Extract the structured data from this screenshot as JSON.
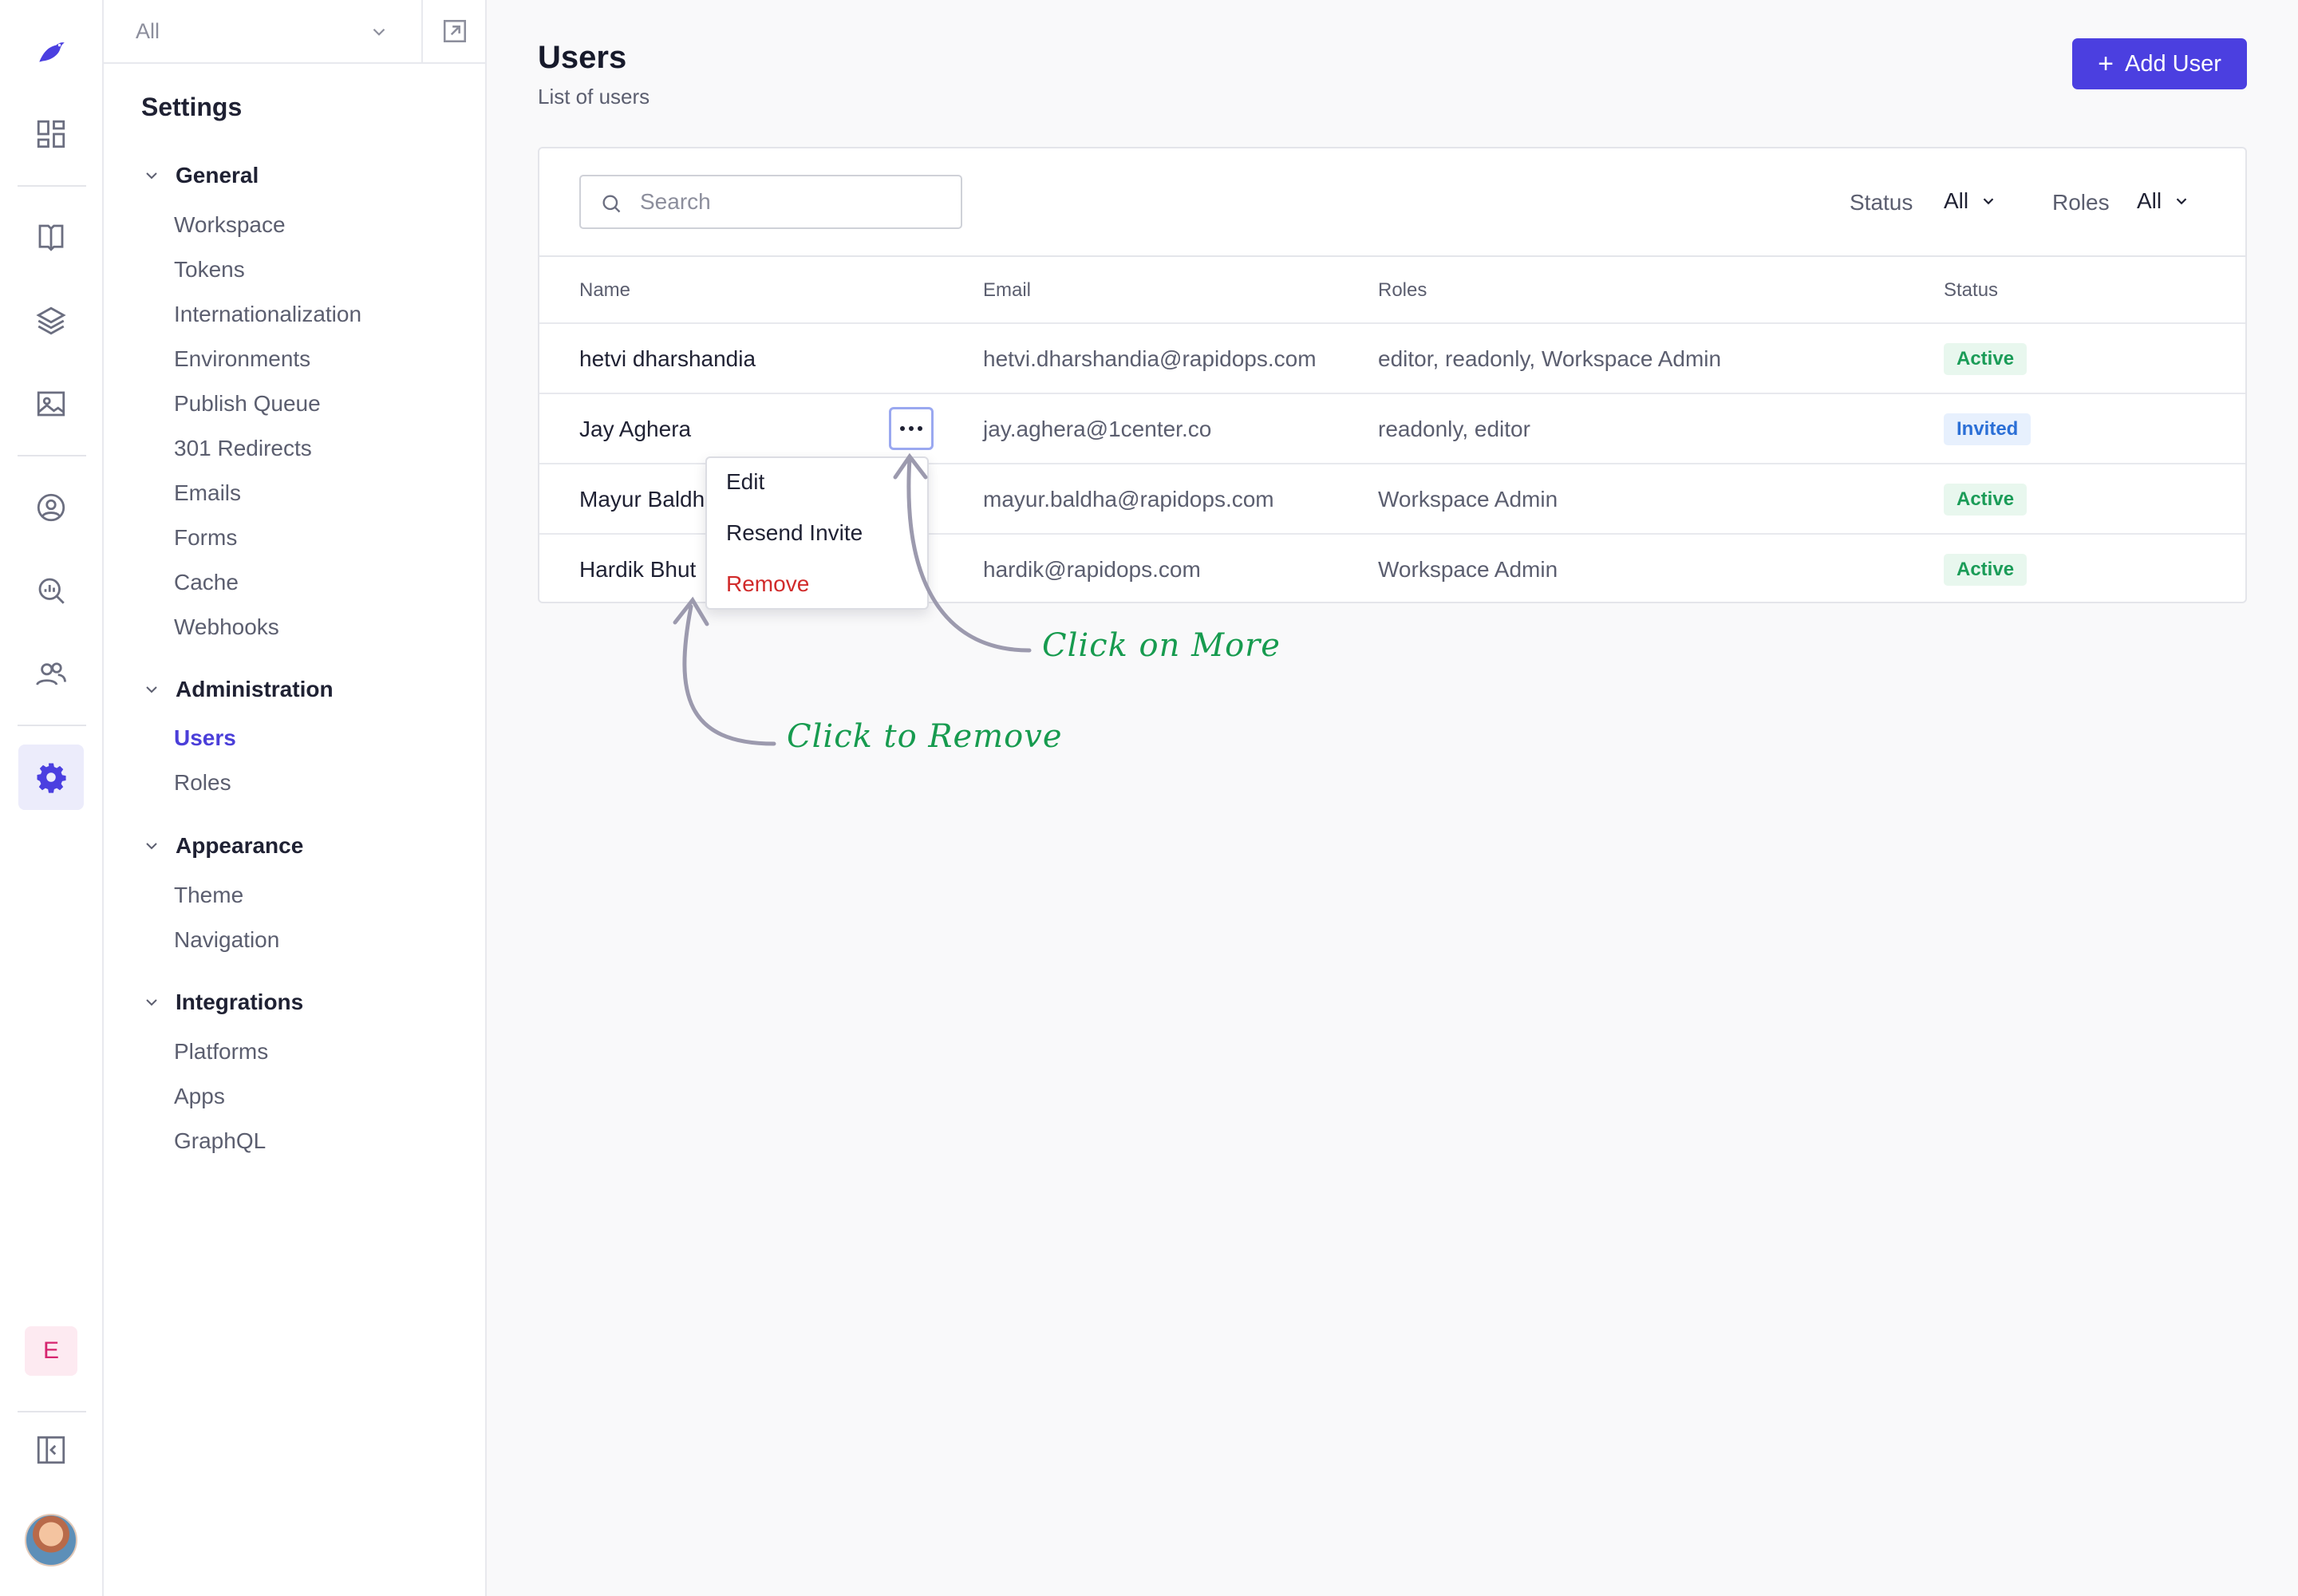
{
  "rail": {
    "items": [
      {
        "icon": "bird-logo-icon"
      },
      {
        "icon": "dashboard-icon"
      },
      {
        "icon": "book-icon"
      },
      {
        "icon": "layers-icon"
      },
      {
        "icon": "image-icon"
      },
      {
        "icon": "user-circle-icon"
      },
      {
        "icon": "analytics-search-icon"
      },
      {
        "icon": "users-icon"
      },
      {
        "icon": "settings-gear-icon",
        "active": true
      }
    ],
    "env_badge": "E",
    "collapse_icon": "sidebar-collapse-icon",
    "avatar_icon": "user-avatar"
  },
  "subnav": {
    "scope": "All",
    "title": "Settings",
    "groups": [
      {
        "label": "General",
        "items": [
          "Workspace",
          "Tokens",
          "Internationalization",
          "Environments",
          "Publish Queue",
          "301 Redirects",
          "Emails",
          "Forms",
          "Cache",
          "Webhooks"
        ]
      },
      {
        "label": "Administration",
        "items": [
          "Users",
          "Roles"
        ]
      },
      {
        "label": "Appearance",
        "items": [
          "Theme",
          "Navigation"
        ]
      },
      {
        "label": "Integrations",
        "items": [
          "Platforms",
          "Apps",
          "GraphQL"
        ]
      }
    ],
    "active_item": "Users"
  },
  "main": {
    "title": "Users",
    "subtitle": "List of users",
    "add_button": "Add User",
    "search_placeholder": "Search",
    "filters": {
      "status_label": "Status",
      "status_value": "All",
      "roles_label": "Roles",
      "roles_value": "All"
    },
    "columns": [
      "Name",
      "Email",
      "Roles",
      "Status"
    ],
    "rows": [
      {
        "name": "hetvi dharshandia",
        "email": "hetvi.dharshandia@rapidops.com",
        "roles": "editor, readonly, Workspace Admin",
        "status": "Active"
      },
      {
        "name": "Jay Aghera",
        "email": "jay.aghera@1center.co",
        "roles": "readonly, editor",
        "status": "Invited"
      },
      {
        "name": "Mayur Baldh",
        "email": "mayur.baldha@rapidops.com",
        "roles": "Workspace Admin",
        "status": "Active"
      },
      {
        "name": "Hardik Bhut",
        "email": "hardik@rapidops.com",
        "roles": "Workspace Admin",
        "status": "Active"
      }
    ],
    "row_menu": [
      "Edit",
      "Resend Invite",
      "Remove"
    ]
  },
  "annotations": {
    "more": "Click on More",
    "remove": "Click to Remove"
  },
  "colors": {
    "accent": "#4b3fe0",
    "active_badge": "#1b9c58",
    "invited_badge": "#2b6fd6",
    "danger": "#d12b2b",
    "annotation": "#179b4f"
  }
}
